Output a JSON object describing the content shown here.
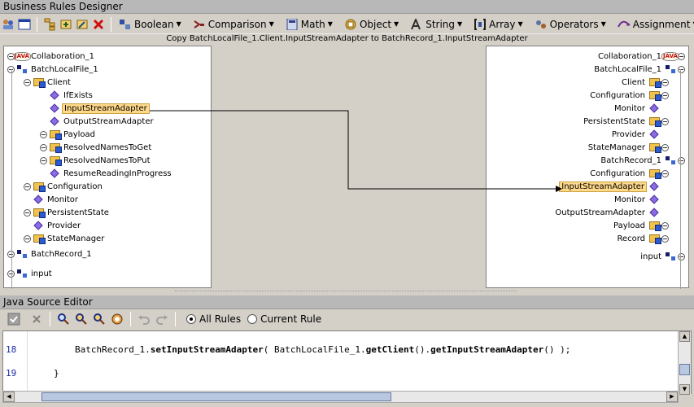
{
  "brd": {
    "title": "Business Rules Designer",
    "menus": [
      {
        "label": "Boolean"
      },
      {
        "label": "Comparison"
      },
      {
        "label": "Math"
      },
      {
        "label": "Object"
      },
      {
        "label": "String"
      },
      {
        "label": "Array"
      },
      {
        "label": "Operators"
      },
      {
        "label": "Assignment"
      }
    ],
    "caption": "Copy BatchLocalFile_1.Client.InputStreamAdapter to BatchRecord_1.InputStreamAdapter"
  },
  "left_tree": [
    {
      "label": "Collaboration_1",
      "icon": "java-icon",
      "depth": 0,
      "expander": true
    },
    {
      "label": "BatchLocalFile_1",
      "icon": "struct-icon",
      "depth": 0,
      "expander": true
    },
    {
      "label": "Client",
      "icon": "folder-icon",
      "depth": 1,
      "expander": true
    },
    {
      "label": "IfExists",
      "icon": "diamond-icon",
      "depth": 2,
      "expander": false
    },
    {
      "label": "InputStreamAdapter",
      "icon": "diamond-icon",
      "depth": 2,
      "expander": false,
      "selected": true
    },
    {
      "label": "OutputStreamAdapter",
      "icon": "diamond-icon",
      "depth": 2,
      "expander": false
    },
    {
      "label": "Payload",
      "icon": "folder-icon",
      "depth": 2,
      "expander": true
    },
    {
      "label": "ResolvedNamesToGet",
      "icon": "folder-icon",
      "depth": 2,
      "expander": true
    },
    {
      "label": "ResolvedNamesToPut",
      "icon": "folder-icon",
      "depth": 2,
      "expander": true
    },
    {
      "label": "ResumeReadingInProgress",
      "icon": "diamond-icon",
      "depth": 2,
      "expander": false
    },
    {
      "label": "Configuration",
      "icon": "folder-icon",
      "depth": 1,
      "expander": true
    },
    {
      "label": "Monitor",
      "icon": "diamond-icon",
      "depth": 1,
      "expander": false
    },
    {
      "label": "PersistentState",
      "icon": "folder-icon",
      "depth": 1,
      "expander": true
    },
    {
      "label": "Provider",
      "icon": "diamond-icon",
      "depth": 1,
      "expander": false
    },
    {
      "label": "StateManager",
      "icon": "folder-icon",
      "depth": 1,
      "expander": true
    },
    {
      "label": "BatchRecord_1",
      "icon": "struct-icon",
      "depth": 0,
      "expander": true
    },
    {
      "label": "input",
      "icon": "struct-icon",
      "depth": 0,
      "expander": true
    }
  ],
  "right_tree": [
    {
      "label": "Collaboration_1",
      "icon": "java-icon",
      "depth": 0,
      "expander": true
    },
    {
      "label": "BatchLocalFile_1",
      "icon": "struct-icon",
      "depth": 0,
      "expander": true
    },
    {
      "label": "Client",
      "icon": "folder-icon",
      "depth": 1,
      "expander": true
    },
    {
      "label": "Configuration",
      "icon": "folder-icon",
      "depth": 1,
      "expander": true
    },
    {
      "label": "Monitor",
      "icon": "diamond-icon",
      "depth": 1,
      "expander": false
    },
    {
      "label": "PersistentState",
      "icon": "folder-icon",
      "depth": 1,
      "expander": true
    },
    {
      "label": "Provider",
      "icon": "diamond-icon",
      "depth": 1,
      "expander": false
    },
    {
      "label": "StateManager",
      "icon": "folder-icon",
      "depth": 1,
      "expander": true
    },
    {
      "label": "BatchRecord_1",
      "icon": "struct-icon",
      "depth": 0,
      "expander": true
    },
    {
      "label": "Configuration",
      "icon": "folder-icon",
      "depth": 1,
      "expander": true
    },
    {
      "label": "InputStreamAdapter",
      "icon": "diamond-icon",
      "depth": 1,
      "expander": false,
      "selected": true
    },
    {
      "label": "Monitor",
      "icon": "diamond-icon",
      "depth": 1,
      "expander": false
    },
    {
      "label": "OutputStreamAdapter",
      "icon": "diamond-icon",
      "depth": 1,
      "expander": false
    },
    {
      "label": "Payload",
      "icon": "folder-icon",
      "depth": 1,
      "expander": true
    },
    {
      "label": "Record",
      "icon": "folder-icon",
      "depth": 1,
      "expander": true
    },
    {
      "label": "input",
      "icon": "struct-icon",
      "depth": 0,
      "expander": true
    }
  ],
  "jse": {
    "title": "Java Source Editor",
    "radio_all": "All Rules",
    "radio_current": "Current Rule",
    "selected_radio": "all",
    "lines": [
      {
        "no": "18",
        "code": [
          {
            "t": "BatchRecord_1.",
            "b": false
          },
          {
            "t": "setInputStreamAdapter",
            "b": true
          },
          {
            "t": "( BatchLocalFile_1.",
            "b": false
          },
          {
            "t": "getClient",
            "b": true
          },
          {
            "t": "().",
            "b": false
          },
          {
            "t": "getInputStreamAdapter",
            "b": true
          },
          {
            "t": "() );",
            "b": false
          }
        ]
      },
      {
        "no": "19",
        "code": [
          {
            "t": "}",
            "b": false
          }
        ]
      }
    ]
  },
  "colors": {
    "selection": "#ffd98a",
    "title_bar": "#b8b8b8",
    "background": "#d4d0c8",
    "line_numbers": "#1a2aa0"
  }
}
